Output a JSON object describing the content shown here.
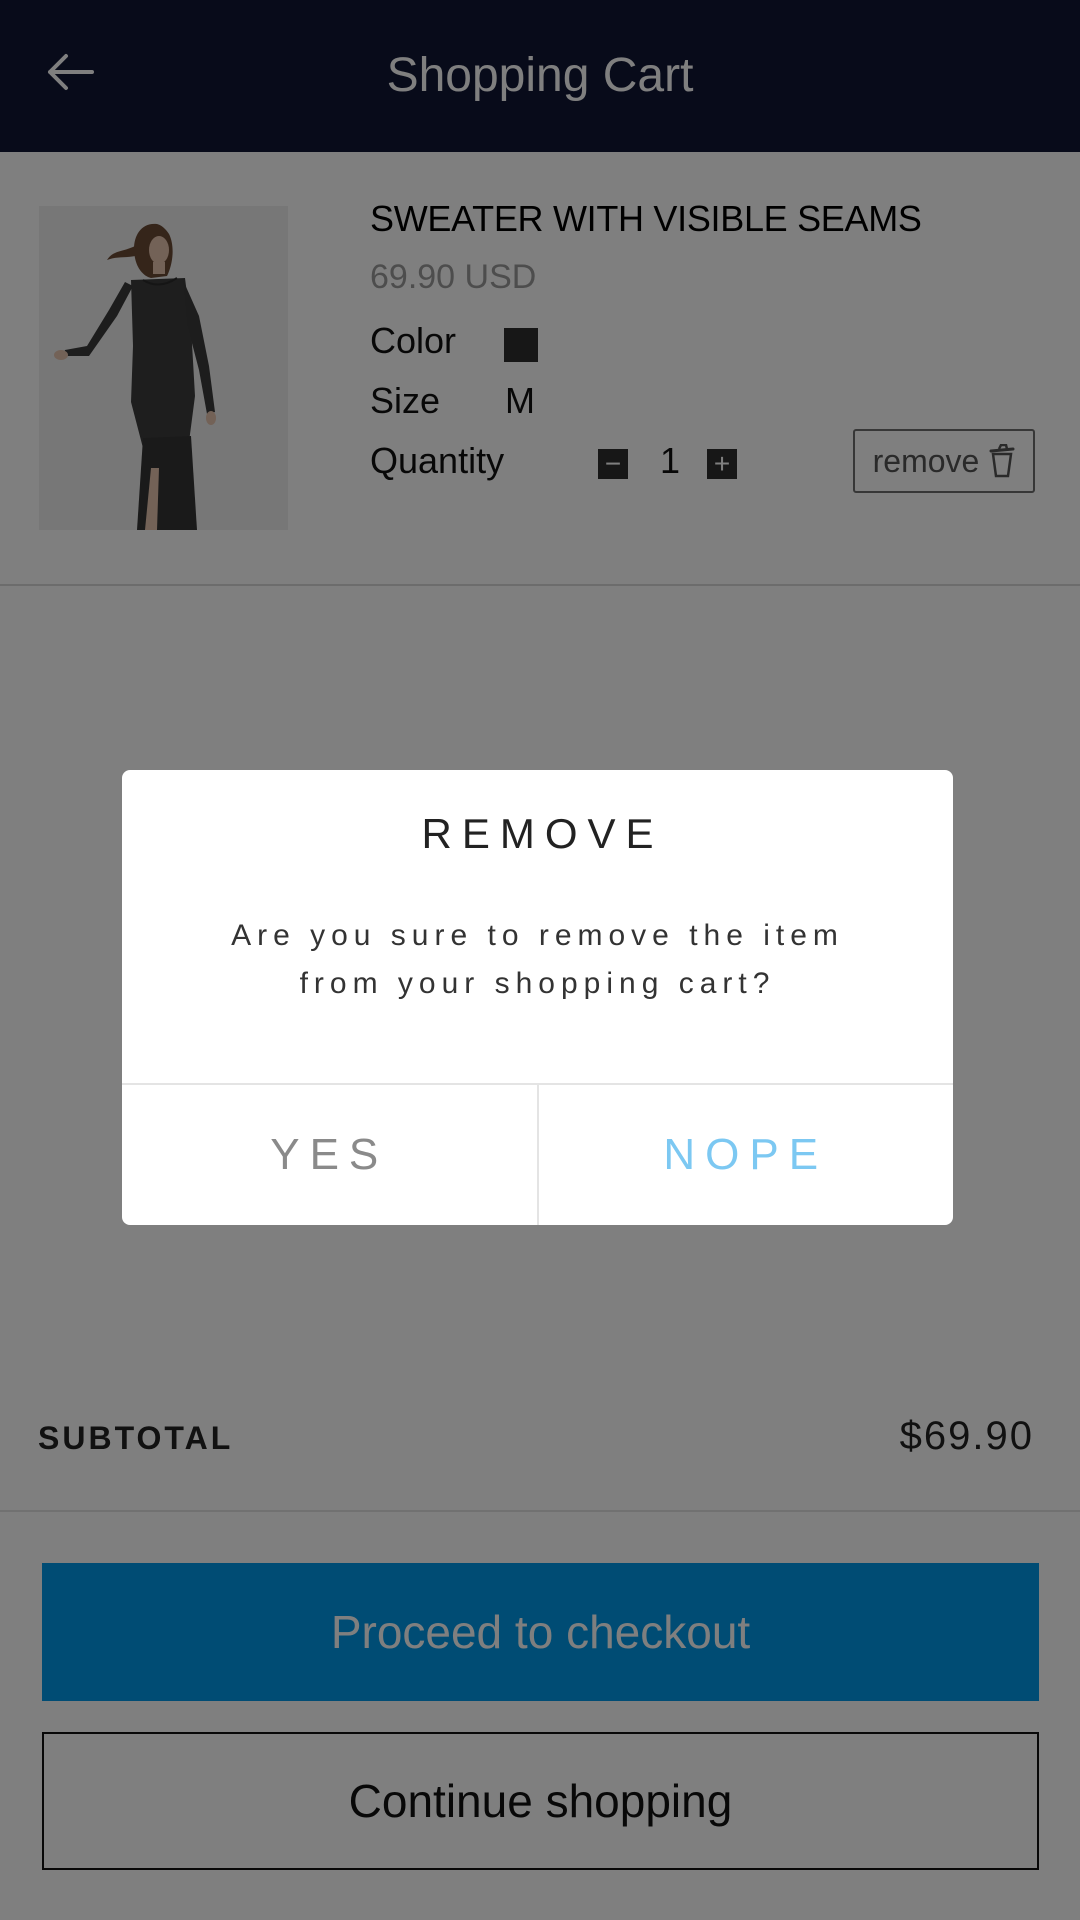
{
  "header": {
    "title": "Shopping Cart"
  },
  "cart_item": {
    "name": "SWEATER WITH VISIBLE SEAMS",
    "price": "69.90 USD",
    "color_label": "Color",
    "color_value": "#2f2f2f",
    "size_label": "Size",
    "size_value": "M",
    "quantity_label": "Quantity",
    "quantity": "1",
    "qty_minus": "−",
    "qty_plus": "+",
    "remove_label": "remove"
  },
  "summary": {
    "subtotal_label": "SUBTOTAL",
    "subtotal_value": "$69.90"
  },
  "actions": {
    "checkout_label": "Proceed to checkout",
    "continue_label": "Continue shopping"
  },
  "modal": {
    "title": "REMOVE",
    "message": "Are you sure to remove the item from your shopping cart?",
    "yes_label": "YES",
    "nope_label": "NOPE"
  },
  "colors": {
    "header_bg": "#101634",
    "checkout_bg": "#0199e9",
    "nope_text": "#7cc8f2"
  }
}
